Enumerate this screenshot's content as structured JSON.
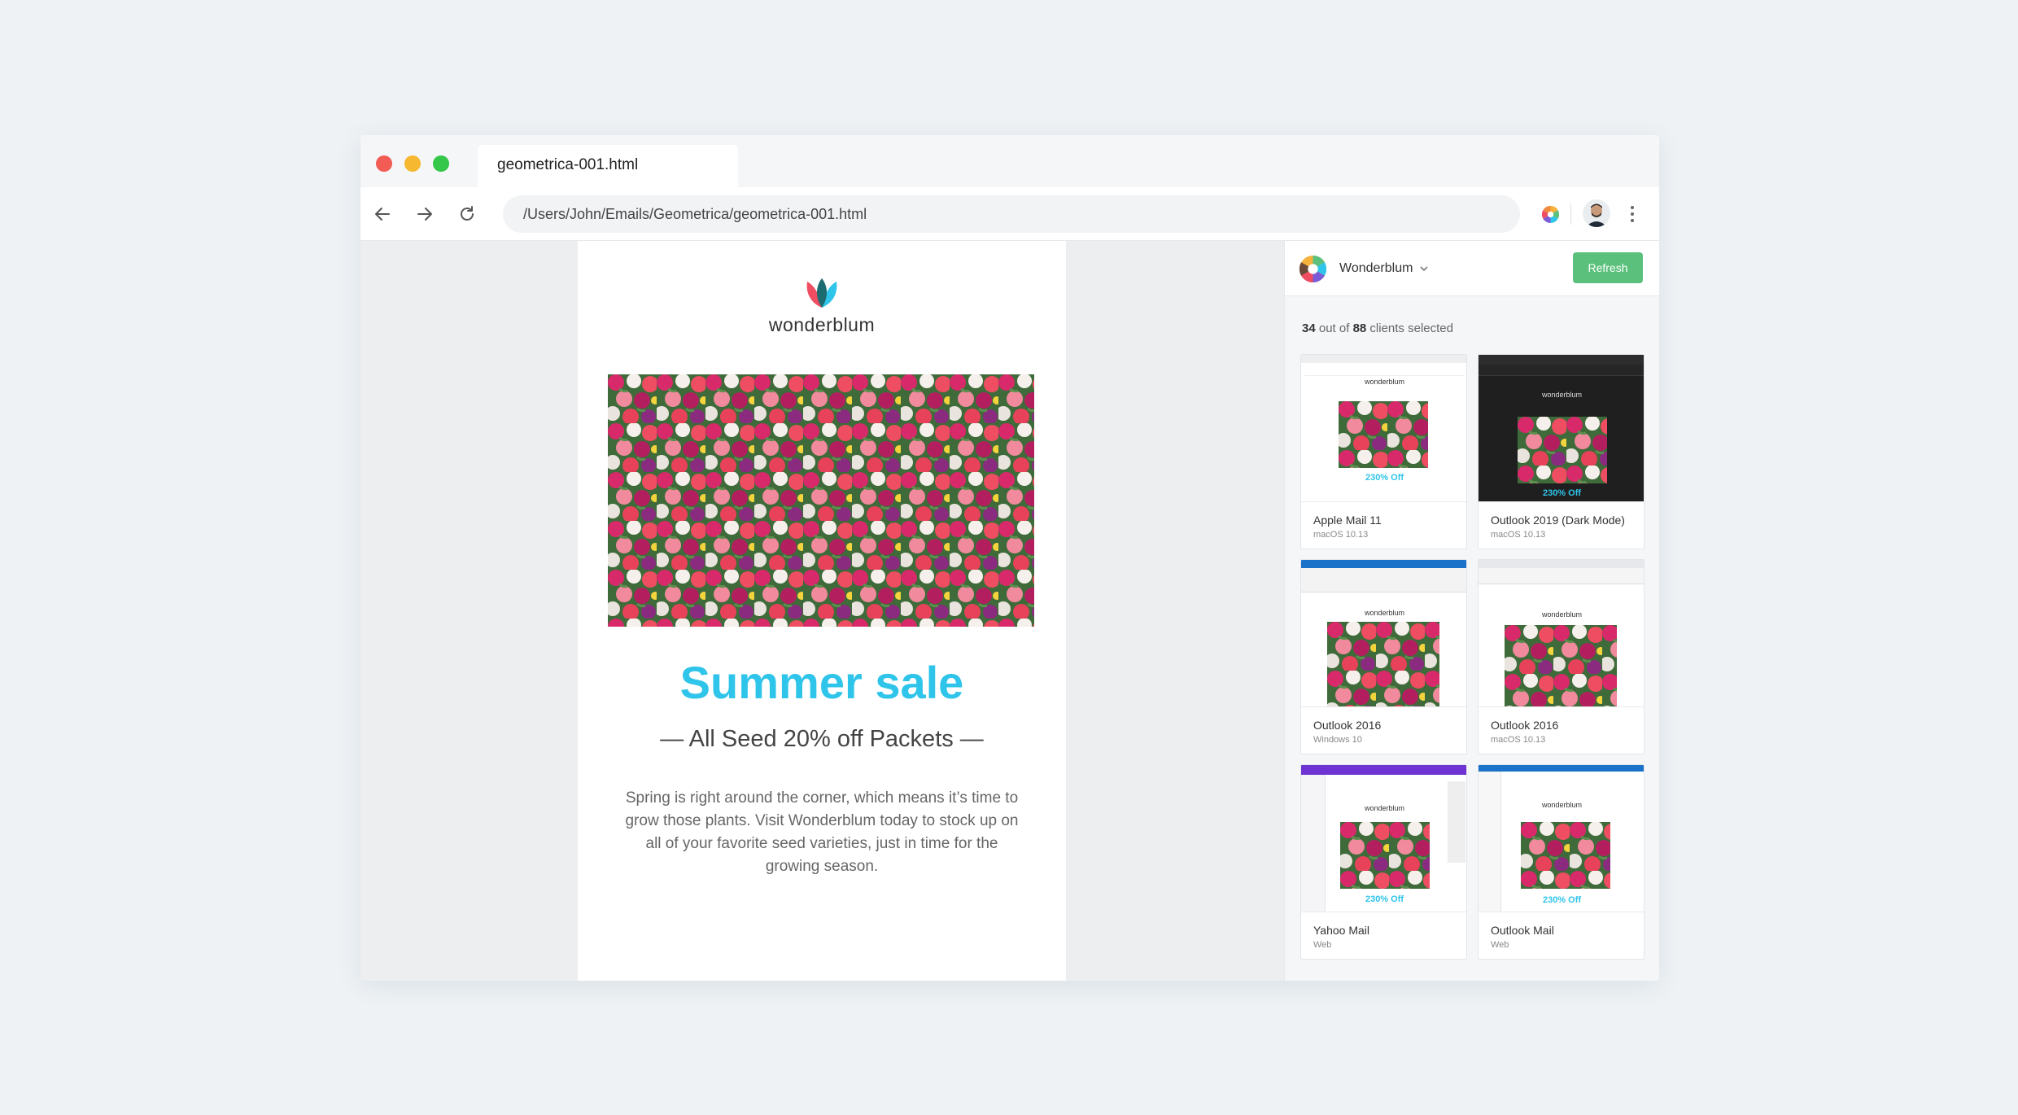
{
  "window": {
    "tab_title": "geometrica-001.html",
    "address": "/Users/John/Emails/Geometrica/geometrica-001.html"
  },
  "email": {
    "brand": "wonderblum",
    "headline": "Summer sale",
    "subheadline": "— All Seed 20% off Packets —",
    "body": "Spring is right around the corner, which means it’s time to grow those plants. Visit Wonderblum today to stock up on all of your favorite seed varieties, just in time for the growing season.",
    "headline_color": "#2fc4ea"
  },
  "panel": {
    "workspace": "Wonderblum",
    "refresh_label": "Refresh",
    "refresh_color": "#5bc07b",
    "count_selected": "34",
    "count_mid": " out of ",
    "count_total": "88",
    "count_suffix": " clients selected",
    "clients": [
      {
        "name": "Apple Mail 11",
        "os": "macOS 10.13",
        "preview_off": "230% Off"
      },
      {
        "name": "Outlook 2019 (Dark Mode)",
        "os": "macOS 10.13",
        "preview_off": "230% Off"
      },
      {
        "name": "Outlook 2016",
        "os": "Windows 10"
      },
      {
        "name": "Outlook 2016",
        "os": "macOS 10.13"
      },
      {
        "name": "Yahoo Mail",
        "os": "Web",
        "preview_off": "230% Off"
      },
      {
        "name": "Outlook Mail",
        "os": "Web",
        "preview_off": "230% Off"
      }
    ]
  }
}
